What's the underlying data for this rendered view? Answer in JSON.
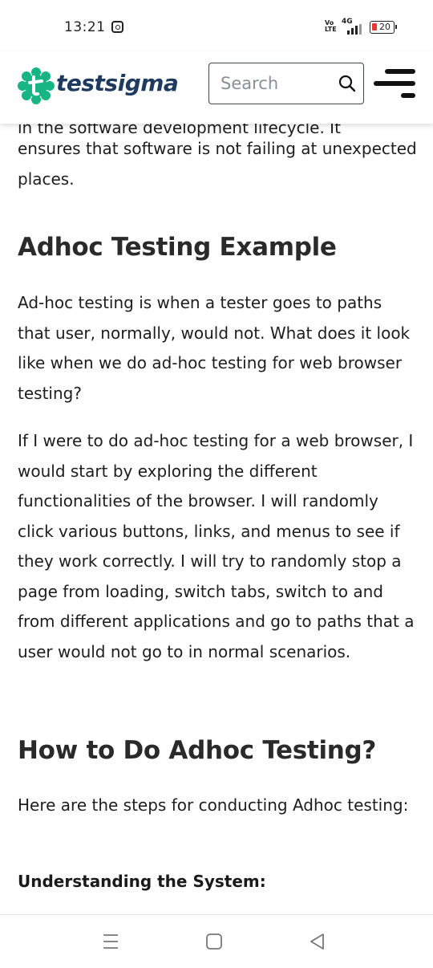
{
  "status_bar": {
    "time": "13:21",
    "volte": "Vo\nLTE",
    "network": "4G",
    "battery": "20"
  },
  "header": {
    "logo_text": "testsigma",
    "brand_color": "#1f3a5f",
    "logo_mark_color": "#17b581",
    "search_placeholder": "Search"
  },
  "article": {
    "cut_off_line": "in the software development lifecycle. It",
    "intro_text": "ensures that software is not failing at unexpected places.",
    "section1_heading": "Adhoc Testing Example",
    "section1_para1": "Ad-hoc testing is when a tester goes to paths that user, normally, would not. What does it look like when we do ad-hoc testing for web browser testing?",
    "section1_para2": "If I were to do ad-hoc testing for a web browser, I would start by exploring the different functionalities of the browser. I will randomly click various buttons, links, and menus to see if they work correctly. I will try to randomly stop a page from loading, switch tabs, switch to and from different applications and go to paths that a user would not go to in normal scenarios.",
    "section2_heading": "How to Do Adhoc Testing?",
    "section2_para1": "Here are the steps for conducting Adhoc testing:",
    "step1_heading": "Understanding the System:"
  },
  "nav": {
    "recents": "recents-icon",
    "home": "home-icon",
    "back": "back-icon"
  }
}
